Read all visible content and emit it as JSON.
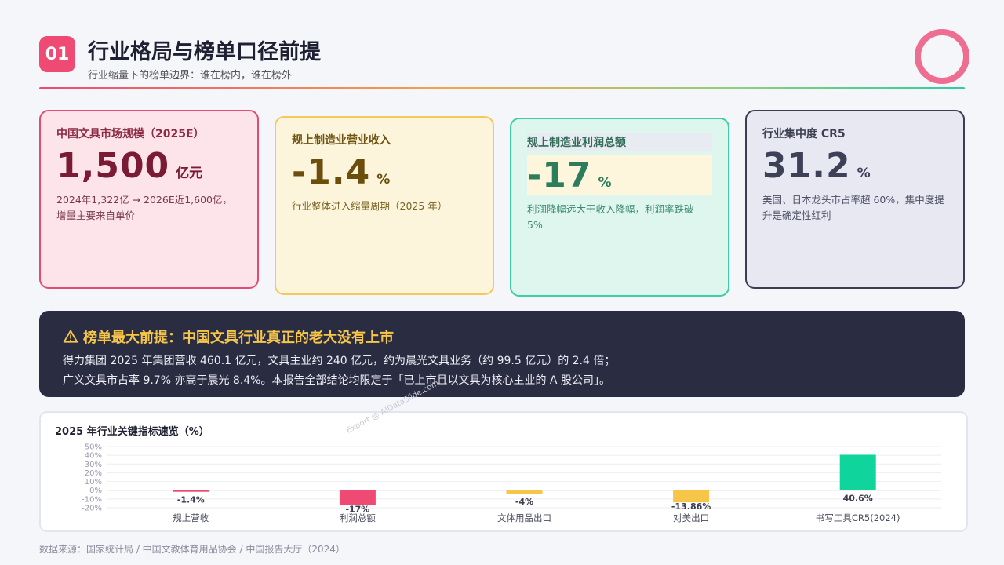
{
  "header": {
    "badge": "01",
    "title": "行业格局与榜单口径前提",
    "subtitle": "行业缩量下的榜单边界：谁在榜内，谁在榜外"
  },
  "kpis": [
    {
      "label": "中国文具市场规模（2025E）",
      "value": "1,500",
      "unit": "亿元",
      "desc": "2024年1,322亿 → 2026E近1,600亿，增量主要来自单价"
    },
    {
      "label": "规上制造业营业收入",
      "value": "-1.4",
      "unit": "%",
      "desc": "行业整体进入缩量周期（2025 年）"
    },
    {
      "label": "规上制造业利润总额",
      "value": "-17",
      "unit": "%",
      "desc": "利润降幅远大于收入降幅，利润率跌破 5%"
    },
    {
      "label": "行业集中度 CR5",
      "value": "31.2",
      "unit": "%",
      "desc": "美国、日本龙头市占率超 60%，集中度提升是确定性红利"
    }
  ],
  "alert": {
    "icon": "warning-triangle-icon",
    "heading": "榜单最大前提：中国文具行业真正的老大没有上市",
    "line1": "得力集团 2025 年集团营收 460.1 亿元，文具主业约 240 亿元，约为晨光文具业务（约 99.5 亿元）的 2.4 倍；",
    "line2": "广义文具市占率 9.7% 亦高于晨光 8.4%。本报告全部结论均限定于「已上市且以文具为核心主业的 A 股公司」。"
  },
  "watermark": "Export @ AIDataSlide.com",
  "chart_data": {
    "type": "bar",
    "title": "2025 年行业关键指标速览（%）",
    "categories": [
      "规上营收",
      "利润总额",
      "文体用品出口",
      "对美出口",
      "书写工具CR5(2024)"
    ],
    "values": [
      -1.4,
      -17,
      -4,
      -13.86,
      40.6
    ],
    "data_labels": [
      "-1.4%",
      "-17%",
      "-4%",
      "-13.86%",
      "40.6%"
    ],
    "colors": [
      "#ee4a74",
      "#ee4a74",
      "#f6c649",
      "#f6c649",
      "#0fd49b"
    ],
    "yticks": [
      "50%",
      "40%",
      "30%",
      "20%",
      "10%",
      "0%",
      "-10%",
      "-20%"
    ],
    "ylim": [
      -20,
      50
    ],
    "grid": true,
    "xlabel": "",
    "ylabel": ""
  },
  "footer": {
    "source": "数据来源：国家统计局 / 中国文教体育用品协会 / 中国报告大厅（2024）"
  }
}
